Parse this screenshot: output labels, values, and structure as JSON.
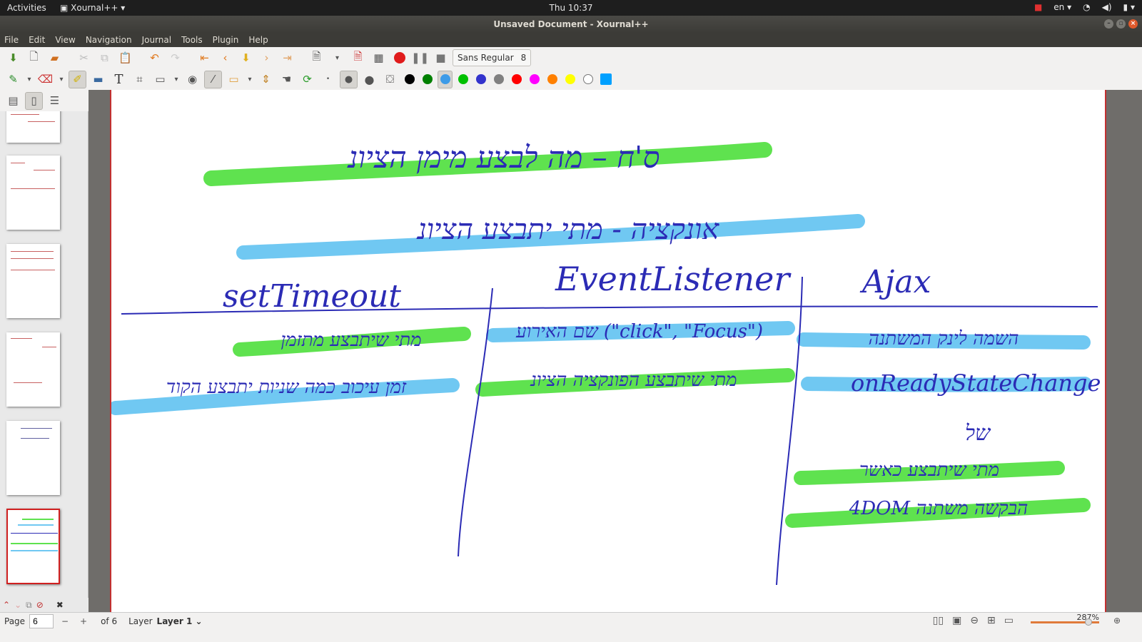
{
  "topbar": {
    "activities": "Activities",
    "app_name": "Xournal++",
    "clock": "Thu 10:37",
    "language": "en"
  },
  "window": {
    "title": "Unsaved Document - Xournal++"
  },
  "menu": [
    "File",
    "Edit",
    "View",
    "Navigation",
    "Journal",
    "Tools",
    "Plugin",
    "Help"
  ],
  "toolbar": {
    "font_name": "Sans Regular",
    "font_size": "8",
    "colors": [
      "#000000",
      "#008000",
      "#3d9be8",
      "#00c000",
      "#3333cc",
      "#808080",
      "#ff0000",
      "#ff00ff",
      "#ff8000",
      "#ffff00",
      "#ffffff",
      "#00a0ff"
    ],
    "selected_color": "#3d9be8"
  },
  "canvas": {
    "line1": "ס'ח – מה לבצע מימן הציונ",
    "line2": "אונקציה - מתי יתבצע הציונ",
    "col_headers": [
      "setTimeout",
      "EventListener",
      "Ajax"
    ],
    "setTimeout_rows": [
      "מתי שיתבצע מתזמן",
      "זמן עיכוב כמה שניות יתבצע הקוד"
    ],
    "event_rows": [
      "(\"click\", \"Focus\") שם האירוע",
      "מתי שיתבצע הפונקציה הציונ"
    ],
    "ajax_rows": [
      "השמה לינק המשתנה",
      "onReadyStateChange",
      "של",
      "מתי שיתבצע כאשר",
      "הבקשה משתנה 4DOM"
    ]
  },
  "statusbar": {
    "page_label": "Page",
    "page_value": "6",
    "of_label": "of 6",
    "layer_label": "Layer",
    "layer_value": "Layer 1",
    "zoom": "287%"
  }
}
